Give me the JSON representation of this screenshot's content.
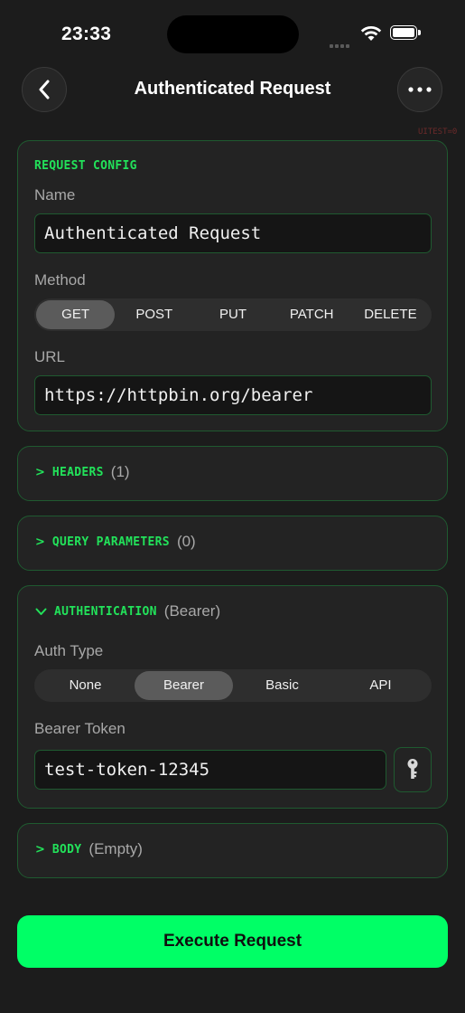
{
  "status_bar": {
    "time": "23:33"
  },
  "nav": {
    "title": "Authenticated Request",
    "back_icon": "chevron-left-icon",
    "more_icon": "ellipsis-icon"
  },
  "debug_tag": "UITEST=0",
  "request_config": {
    "section_title": "REQUEST CONFIG",
    "name_label": "Name",
    "name_value": "Authenticated Request",
    "method_label": "Method",
    "methods": [
      "GET",
      "POST",
      "PUT",
      "PATCH",
      "DELETE"
    ],
    "selected_method": "GET",
    "url_label": "URL",
    "url_value": "https://httpbin.org/bearer"
  },
  "headers": {
    "title": "HEADERS",
    "count": "(1)",
    "expanded": false
  },
  "query_parameters": {
    "title": "QUERY PARAMETERS",
    "count": "(0)",
    "expanded": false
  },
  "authentication": {
    "title": "AUTHENTICATION",
    "type_summary": "(Bearer)",
    "expanded": true,
    "auth_type_label": "Auth Type",
    "auth_types": [
      "None",
      "Bearer",
      "Basic",
      "API"
    ],
    "selected_auth_type": "Bearer",
    "token_label": "Bearer Token",
    "token_value": "test-token-12345",
    "key_icon": "key-icon"
  },
  "body": {
    "title": "BODY",
    "summary": "(Empty)",
    "expanded": false
  },
  "execute_button": {
    "label": "Execute Request"
  },
  "colors": {
    "accent": "#22e25a",
    "button": "#00ff66",
    "background": "#1c1c1c",
    "card": "#232323",
    "card_border": "#1f5a30"
  }
}
